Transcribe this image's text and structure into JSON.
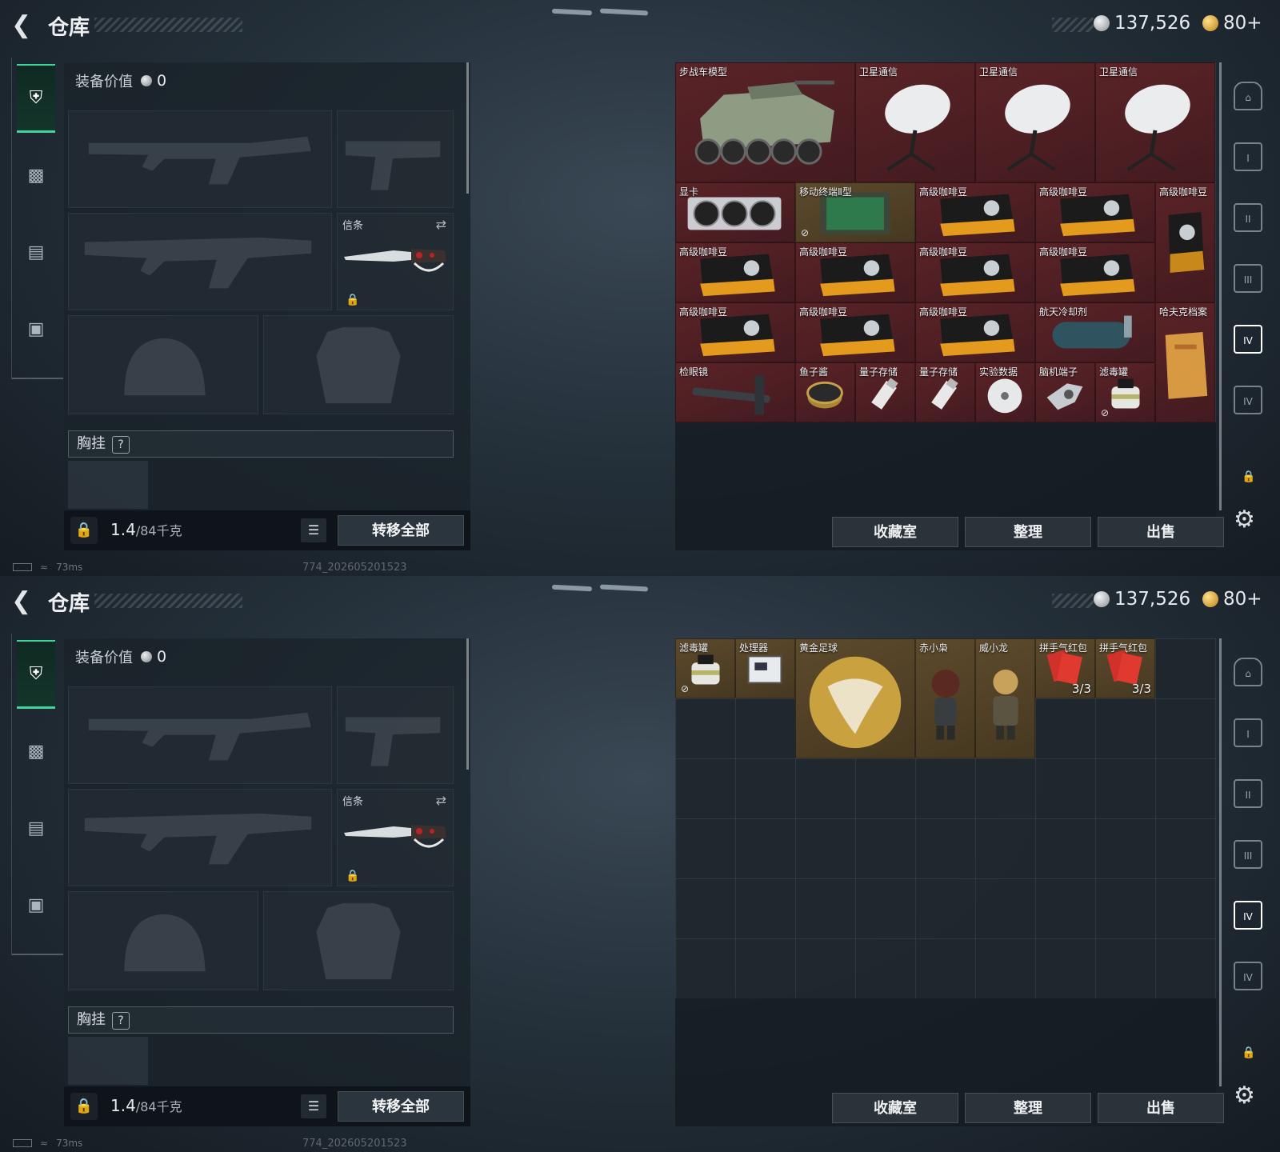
{
  "screens": [
    {
      "header": {
        "title": "仓库",
        "currency_1": "137,526",
        "currency_2": "80+"
      },
      "equipment": {
        "value_label": "装备价值",
        "value": "0",
        "melee_label": "信条",
        "chest_label": "胸挂",
        "chest_help": "?",
        "weight_current": "1.4",
        "weight_max": "/84千克",
        "transfer_all": "转移全部"
      },
      "status": {
        "ping": "73ms",
        "build": "774_202605201523"
      },
      "storage_items": [
        {
          "name": "步战车模型",
          "rarity": "red",
          "icon": "ifv-model"
        },
        {
          "name": "卫星通信",
          "rarity": "red",
          "icon": "satellite-dish"
        },
        {
          "name": "卫星通信",
          "rarity": "red",
          "icon": "satellite-dish"
        },
        {
          "name": "卫星通信",
          "rarity": "red",
          "icon": "satellite-dish"
        },
        {
          "name": "显卡",
          "rarity": "red",
          "icon": "gpu"
        },
        {
          "name": "移动终端Ⅱ型",
          "rarity": "gold",
          "icon": "tablet",
          "mark": "no-trade"
        },
        {
          "name": "高级咖啡豆",
          "rarity": "red",
          "icon": "coffee-bag"
        },
        {
          "name": "高级咖啡豆",
          "rarity": "red",
          "icon": "coffee-bag"
        },
        {
          "name": "高级咖啡豆",
          "rarity": "red",
          "icon": "coffee-bag-tall"
        },
        {
          "name": "高级咖啡豆",
          "rarity": "red",
          "icon": "coffee-bag"
        },
        {
          "name": "高级咖啡豆",
          "rarity": "red",
          "icon": "coffee-bag"
        },
        {
          "name": "高级咖啡豆",
          "rarity": "red",
          "icon": "coffee-bag"
        },
        {
          "name": "高级咖啡豆",
          "rarity": "red",
          "icon": "coffee-bag"
        },
        {
          "name": "高级咖啡豆",
          "rarity": "red",
          "icon": "coffee-bag"
        },
        {
          "name": "高级咖啡豆",
          "rarity": "red",
          "icon": "coffee-bag"
        },
        {
          "name": "高级咖啡豆",
          "rarity": "red",
          "icon": "coffee-bag"
        },
        {
          "name": "航天冷却剂",
          "rarity": "red",
          "icon": "coolant-tank"
        },
        {
          "name": "哈夫克档案",
          "rarity": "red",
          "icon": "folder"
        },
        {
          "name": "检眼镜",
          "rarity": "red",
          "icon": "ophthalmoscope"
        },
        {
          "name": "鱼子酱",
          "rarity": "red",
          "icon": "caviar-tin"
        },
        {
          "name": "量子存储",
          "rarity": "red",
          "icon": "usb-drive"
        },
        {
          "name": "量子存储",
          "rarity": "red",
          "icon": "usb-drive"
        },
        {
          "name": "实验数据",
          "rarity": "red",
          "icon": "disc"
        },
        {
          "name": "脑机端子",
          "rarity": "red",
          "icon": "bci-terminal"
        },
        {
          "name": "滤毒罐",
          "rarity": "red",
          "icon": "gas-filter",
          "mark": "no-trade"
        }
      ],
      "buttons": {
        "collection": "收藏室",
        "sort": "整理",
        "sell": "出售"
      }
    },
    {
      "header": {
        "title": "仓库",
        "currency_1": "137,526",
        "currency_2": "80+"
      },
      "equipment": {
        "value_label": "装备价值",
        "value": "0",
        "melee_label": "信条",
        "chest_label": "胸挂",
        "chest_help": "?",
        "weight_current": "1.4",
        "weight_max": "/84千克",
        "transfer_all": "转移全部"
      },
      "status": {
        "ping": "73ms",
        "build": "774_202605201523"
      },
      "storage_items": [
        {
          "name": "滤毒罐",
          "rarity": "gold",
          "icon": "gas-filter",
          "mark": "no-trade"
        },
        {
          "name": "处理器",
          "rarity": "gold",
          "icon": "processor"
        },
        {
          "name": "黄金足球",
          "rarity": "gold",
          "icon": "golden-football"
        },
        {
          "name": "赤小枭",
          "rarity": "gold",
          "icon": "figure-owl"
        },
        {
          "name": "威小龙",
          "rarity": "gold",
          "icon": "figure-dragon"
        },
        {
          "name": "拼手气红包",
          "rarity": "gold",
          "icon": "red-envelope",
          "count": "3/3"
        },
        {
          "name": "拼手气红包",
          "rarity": "gold",
          "icon": "red-envelope",
          "count": "3/3"
        }
      ],
      "buttons": {
        "collection": "收藏室",
        "sort": "整理",
        "sell": "出售"
      }
    }
  ],
  "colors": {
    "accent_green": "#43d39b",
    "rarity_red": "#4f1f24",
    "rarity_gold": "#524227"
  }
}
